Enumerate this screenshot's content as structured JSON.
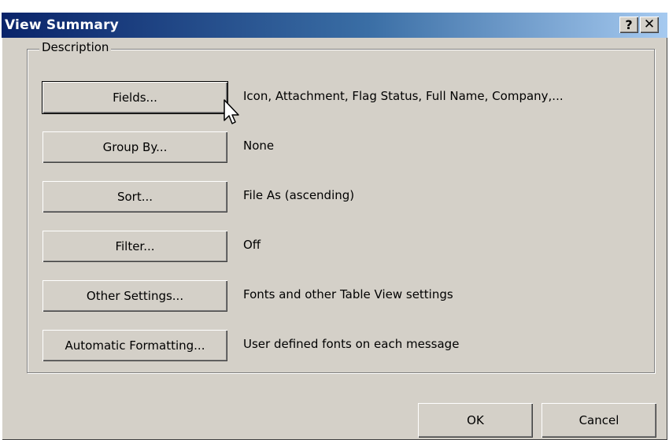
{
  "window": {
    "title": "View Summary",
    "help_label": "?",
    "close_label": "✕"
  },
  "description": {
    "label": "Description",
    "rows": [
      {
        "button": "Fields...",
        "value": "Icon, Attachment, Flag Status, Full Name, Company,..."
      },
      {
        "button": "Group By...",
        "value": "None"
      },
      {
        "button": "Sort...",
        "value": "File As (ascending)"
      },
      {
        "button": "Filter...",
        "value": "Off"
      },
      {
        "button": "Other Settings...",
        "value": "Fonts and other Table View settings"
      },
      {
        "button": "Automatic Formatting...",
        "value": "User defined fonts on each message"
      }
    ]
  },
  "footer": {
    "ok_label": "OK",
    "cancel_label": "Cancel"
  },
  "icons": {
    "cursor": "mouse-pointer-icon",
    "help": "help-icon",
    "close": "close-icon"
  },
  "colors": {
    "dialog_bg": "#d4d0c8",
    "title_start": "#0a246a",
    "title_end": "#a6caf0"
  }
}
